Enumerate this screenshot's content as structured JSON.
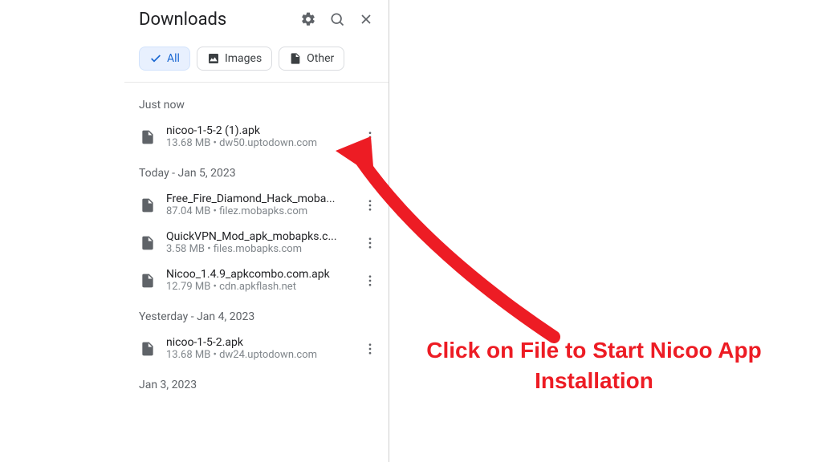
{
  "header": {
    "title": "Downloads"
  },
  "chips": {
    "all": "All",
    "images": "Images",
    "other": "Other"
  },
  "sections": [
    {
      "label": "Just now",
      "items": [
        {
          "name": "nicoo-1-5-2 (1).apk",
          "sub": "13.68 MB • dw50.uptodown.com"
        }
      ]
    },
    {
      "label": "Today - Jan 5, 2023",
      "items": [
        {
          "name": "Free_Fire_Diamond_Hack_moba...",
          "sub": "87.04 MB • filez.mobapks.com"
        },
        {
          "name": "QuickVPN_Mod_apk_mobapks.c...",
          "sub": "3.58 MB • files.mobapks.com"
        },
        {
          "name": "Nicoo_1.4.9_apkcombo.com.apk",
          "sub": "12.79 MB • cdn.apkflash.net"
        }
      ]
    },
    {
      "label": "Yesterday - Jan 4, 2023",
      "items": [
        {
          "name": "nicoo-1-5-2.apk",
          "sub": "13.68 MB • dw24.uptodown.com"
        }
      ]
    },
    {
      "label": "Jan 3, 2023",
      "items": []
    }
  ],
  "annotation": {
    "text": "Click on File to Start Nicoo App Installation",
    "color": "#ed1c24"
  }
}
